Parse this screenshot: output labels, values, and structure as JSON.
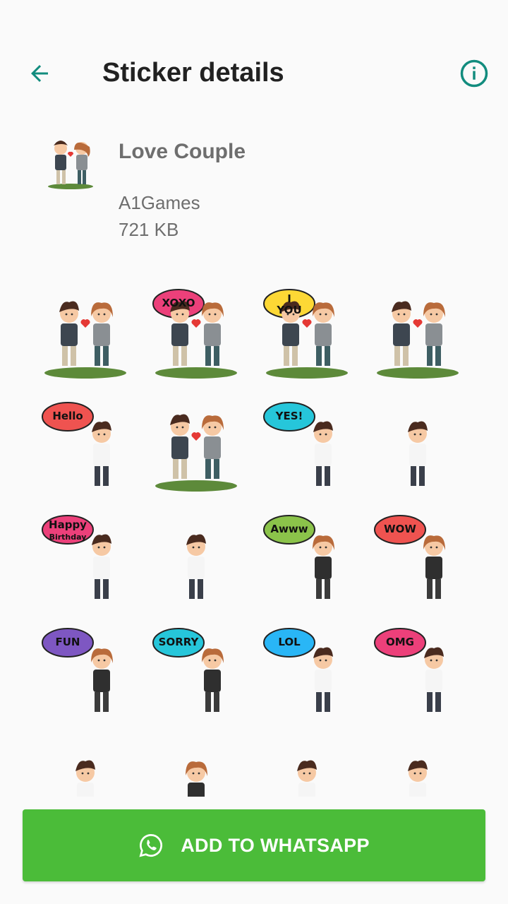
{
  "header": {
    "title": "Sticker details",
    "back_icon": "arrow-left-icon",
    "info_icon": "info-circle-icon",
    "accent": "#128c7e"
  },
  "pack": {
    "name": "Love Couple",
    "publisher": "A1Games",
    "size": "721 KB"
  },
  "stickers": [
    {
      "id": "couple-holding-hands",
      "texts": []
    },
    {
      "id": "xoxo-guitar-couple",
      "texts": [
        "XOXO"
      ]
    },
    {
      "id": "i-love-you-couple",
      "texts": [
        "I",
        "YOU"
      ]
    },
    {
      "id": "couple-on-bench",
      "texts": []
    },
    {
      "id": "hello-boy",
      "texts": [
        "Hello"
      ]
    },
    {
      "id": "couple-at-table",
      "texts": []
    },
    {
      "id": "yes-boy",
      "texts": [
        "YES!"
      ]
    },
    {
      "id": "boy-with-phone",
      "texts": []
    },
    {
      "id": "happy-birthday-boy",
      "texts": [
        "Happy",
        "Birthday"
      ]
    },
    {
      "id": "guitar-boy",
      "texts": []
    },
    {
      "id": "awww-girl-laptop",
      "texts": [
        "Awww"
      ]
    },
    {
      "id": "wow-girl-chair",
      "texts": [
        "WOW"
      ]
    },
    {
      "id": "fun-girl-laptop",
      "texts": [
        "FUN"
      ]
    },
    {
      "id": "sorry-girl",
      "texts": [
        "SORRY"
      ]
    },
    {
      "id": "lol-boy",
      "texts": [
        "LOL"
      ]
    },
    {
      "id": "omg-boy",
      "texts": [
        "OMG"
      ]
    },
    {
      "id": "boy-standing",
      "texts": []
    },
    {
      "id": "girl-with-gift",
      "texts": []
    },
    {
      "id": "boy-cheering",
      "texts": []
    },
    {
      "id": "boy-arms-up",
      "texts": []
    }
  ],
  "action": {
    "label": "ADD TO WHATSAPP",
    "icon": "whatsapp-icon",
    "color": "#4bbc39"
  }
}
